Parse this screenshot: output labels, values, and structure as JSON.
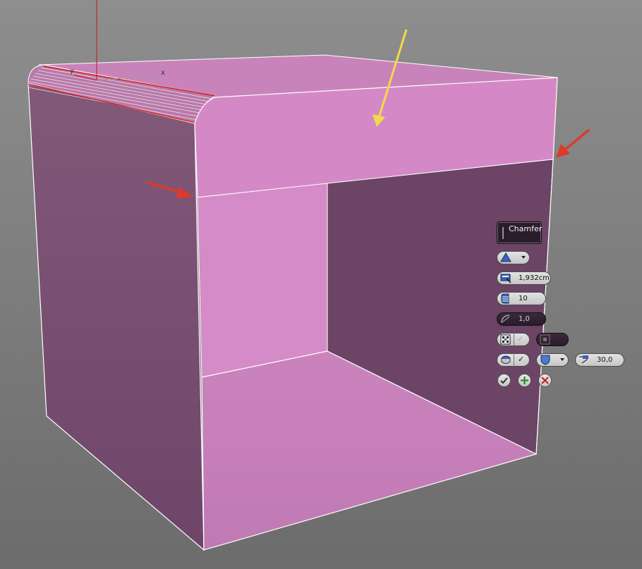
{
  "viewport": {
    "background_top": "#8c8c8c",
    "background_bottom": "#6f6f6f",
    "gizmo_axis_labels": [
      "y",
      "x"
    ],
    "gizmo_axis_colors": {
      "y": "#c81414",
      "x": "#9a9a9a"
    }
  },
  "object": {
    "outer_face_color": "#7a4f72",
    "front_band_color": "#d488c6",
    "top_face_color": "#c784b9",
    "inner_back_color": "#6b4466",
    "inner_left_wall_color": "#d58bc8",
    "inner_floor_color": "#c17ab4",
    "edge_color": "#ffffff",
    "selected_edge_color": "#e01a1a"
  },
  "annotations": [
    {
      "icon": "arrow-icon",
      "color": "#f3d84a"
    },
    {
      "icon": "arrow-icon",
      "color": "#dd3a2a"
    },
    {
      "icon": "arrow-icon",
      "color": "#dd3a2a"
    }
  ],
  "caddy": {
    "title": "Chamfer",
    "mode_icon": "triangle-icon",
    "amount": "1,932cm",
    "segments": "10",
    "tension": "1,0",
    "smooth_threshold": "30,0",
    "accent_color": "#3a62b8",
    "buttons": [
      {
        "icon": "ok-check-icon",
        "color": "#333333"
      },
      {
        "icon": "apply-plus-icon",
        "color": "#2a8a2a"
      },
      {
        "icon": "cancel-x-icon",
        "color": "#c02020"
      }
    ]
  }
}
